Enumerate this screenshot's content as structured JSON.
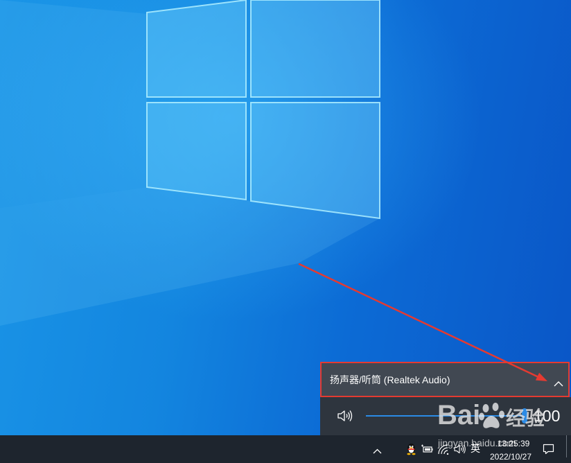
{
  "volume_flyout": {
    "device_name": "扬声器/听筒 (Realtek Audio)",
    "expand_icon": "chevron-up-icon",
    "speaker_icon": "speaker-icon",
    "volume_level": 100,
    "accent_color": "#2b8be6"
  },
  "taskbar": {
    "tray_icons": [
      "chevron-up-icon",
      "qq-icon",
      "battery-icon",
      "wifi-icon",
      "volume-icon"
    ],
    "input_method": "英",
    "time": "13:25:39",
    "date": "2022/10/27",
    "notification_icon": "action-center-icon"
  },
  "watermark": {
    "brand_left": "Bai",
    "brand_right": "经验",
    "url": "jingyan.baidu.com"
  },
  "annotation": {
    "color": "#e53a31"
  }
}
